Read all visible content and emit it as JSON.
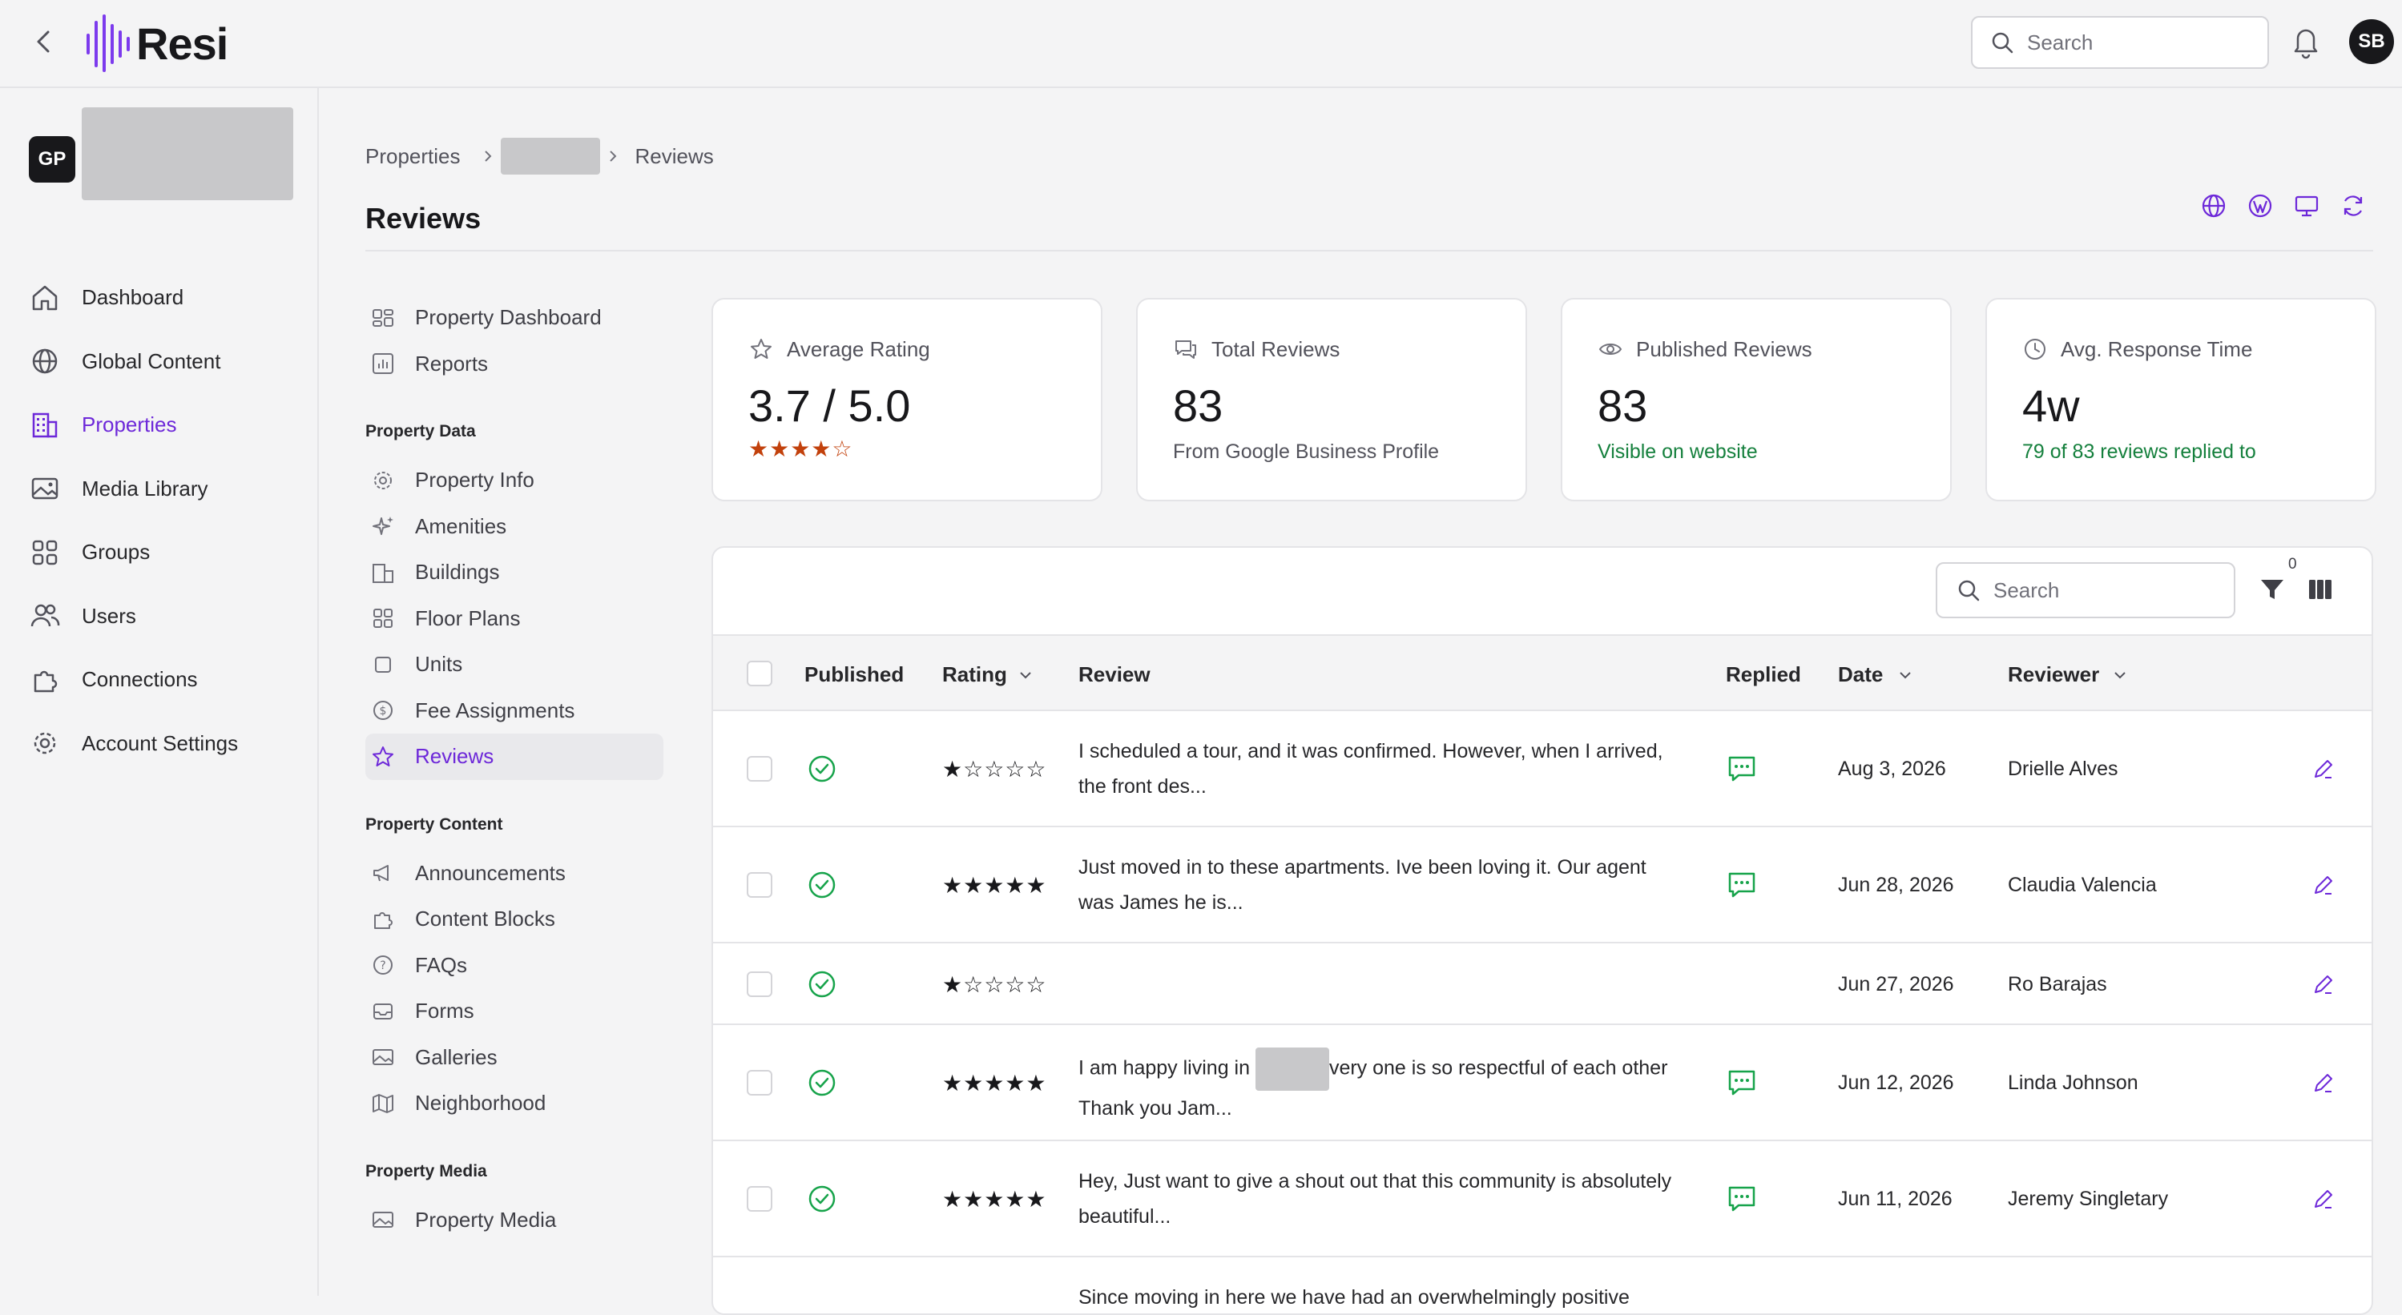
{
  "header": {
    "logo_text": "Resi",
    "search_placeholder": "Search",
    "user_initials": "SB"
  },
  "org": {
    "initials": "GP"
  },
  "sidebar": {
    "items": [
      {
        "label": "Dashboard",
        "icon": "home-icon"
      },
      {
        "label": "Global Content",
        "icon": "globe-icon"
      },
      {
        "label": "Properties",
        "icon": "building-icon",
        "active": true
      },
      {
        "label": "Media Library",
        "icon": "image-icon"
      },
      {
        "label": "Groups",
        "icon": "grid-icon"
      },
      {
        "label": "Users",
        "icon": "users-icon"
      },
      {
        "label": "Connections",
        "icon": "puzzle-icon"
      },
      {
        "label": "Account Settings",
        "icon": "gear-icon"
      }
    ]
  },
  "breadcrumb": {
    "first": "Properties",
    "last": "Reviews"
  },
  "page": {
    "title": "Reviews"
  },
  "subnav": {
    "top": [
      {
        "label": "Property Dashboard"
      },
      {
        "label": "Reports"
      }
    ],
    "sections": [
      {
        "title": "Property Data",
        "items": [
          {
            "label": "Property Info"
          },
          {
            "label": "Amenities"
          },
          {
            "label": "Buildings"
          },
          {
            "label": "Floor Plans"
          },
          {
            "label": "Units"
          },
          {
            "label": "Fee Assignments"
          },
          {
            "label": "Reviews",
            "active": true
          }
        ]
      },
      {
        "title": "Property Content",
        "items": [
          {
            "label": "Announcements"
          },
          {
            "label": "Content Blocks"
          },
          {
            "label": "FAQs"
          },
          {
            "label": "Forms"
          },
          {
            "label": "Galleries"
          },
          {
            "label": "Neighborhood"
          }
        ]
      },
      {
        "title": "Property Media",
        "items": [
          {
            "label": "Property Media"
          }
        ]
      }
    ]
  },
  "stats": [
    {
      "label": "Average Rating",
      "value": "3.7 / 5.0",
      "rating": 3.7,
      "stars": "★★★★☆"
    },
    {
      "label": "Total Reviews",
      "value": "83",
      "sub": "From Google Business Profile"
    },
    {
      "label": "Published Reviews",
      "value": "83",
      "sub": "Visible on website"
    },
    {
      "label": "Avg. Response Time",
      "value": "4w",
      "sub": "79 of 83 reviews replied to"
    }
  ],
  "table": {
    "search_placeholder": "Search",
    "filter_count": "0",
    "columns": {
      "published": "Published",
      "rating": "Rating",
      "review": "Review",
      "replied": "Replied",
      "date": "Date",
      "reviewer": "Reviewer"
    },
    "rows": [
      {
        "rating": 1,
        "stars": "★☆☆☆☆",
        "review": "I scheduled a tour, and it was confirmed. However, when I arrived, the front des...",
        "replied": true,
        "date": "Aug 3, 2026",
        "reviewer": "Drielle Alves"
      },
      {
        "rating": 5,
        "stars": "★★★★★",
        "review": "Just moved in to these apartments. Ive been loving it. Our agent was James he is...",
        "replied": true,
        "date": "Jun 28, 2026",
        "reviewer": "Claudia Valencia"
      },
      {
        "rating": 1,
        "stars": "★☆☆☆☆",
        "review": "",
        "replied": false,
        "date": "Jun 27, 2026",
        "reviewer": "Ro Barajas"
      },
      {
        "rating": 5,
        "stars": "★★★★★",
        "review_a": "I am happy living in ",
        "review_b": "very one is so respectful of each other Thank you Jam...",
        "replied": true,
        "date": "Jun 12, 2026",
        "reviewer": "Linda Johnson"
      },
      {
        "rating": 5,
        "stars": "★★★★★",
        "review": "Hey, Just want to give a shout out that this community is absolutely beautiful...",
        "replied": true,
        "date": "Jun 11, 2026",
        "reviewer": "Jeremy Singletary"
      },
      {
        "review": "Since moving in here we have had an overwhelmingly positive"
      }
    ]
  },
  "colors": {
    "accent": "#6d28d9",
    "green": "#16a34a",
    "star_orange": "#c2410c"
  }
}
